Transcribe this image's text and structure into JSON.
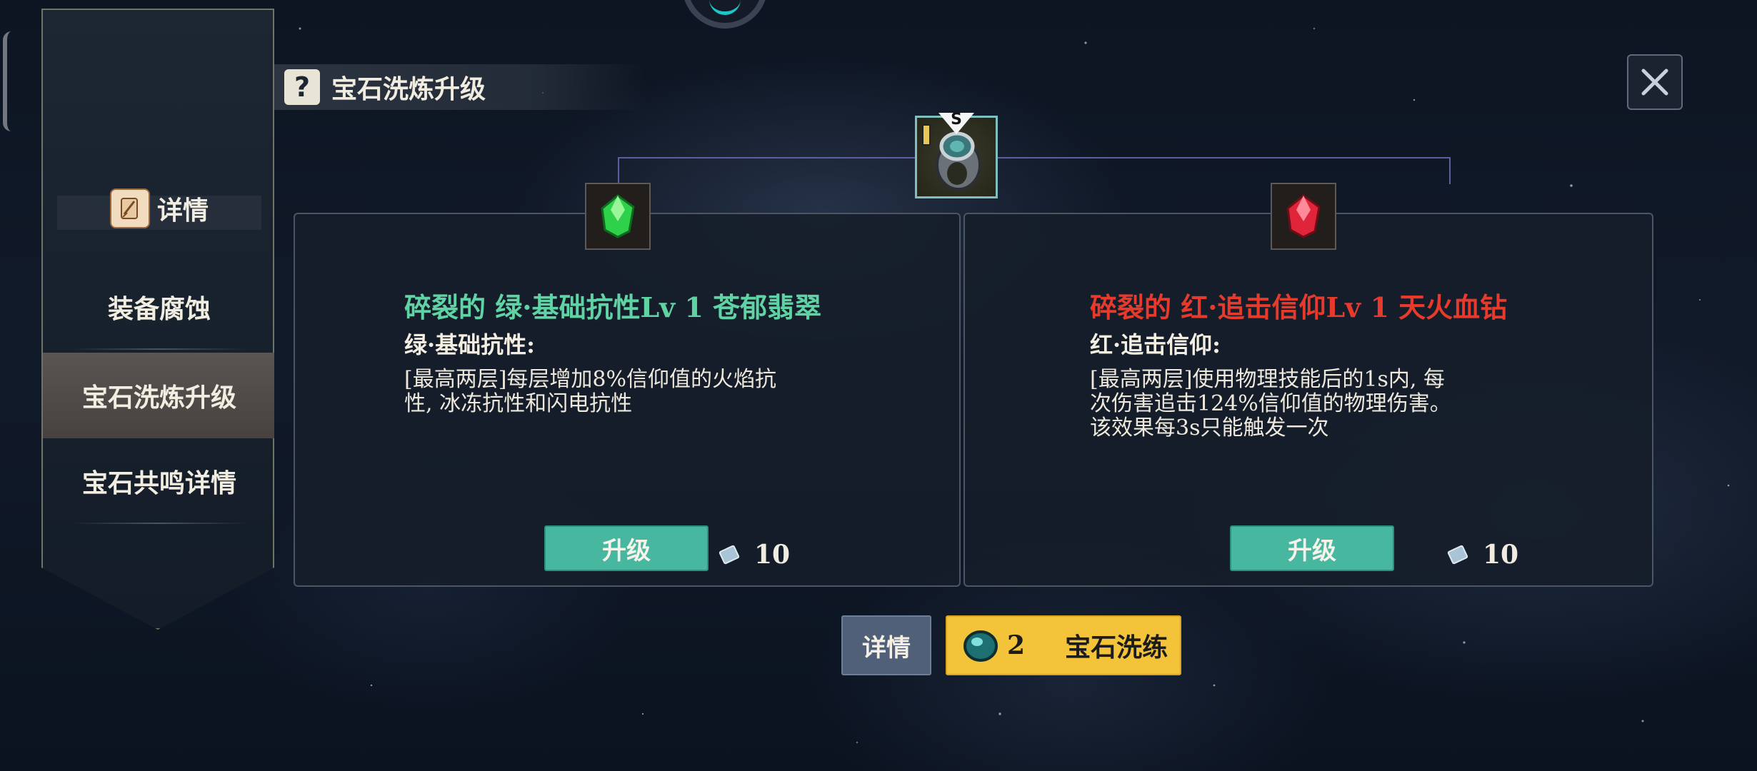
{
  "header": {
    "title": "宝石洗炼升级"
  },
  "sidebar": {
    "items": [
      {
        "label": "详情"
      },
      {
        "label": "装备腐蚀"
      },
      {
        "label": "宝石洗炼升级"
      },
      {
        "label": "宝石共鸣详情"
      }
    ],
    "active_index": 2
  },
  "equipment": {
    "grade_badge": "S"
  },
  "gems": [
    {
      "title": "碎裂的 绿·基础抗性Lv 1 苍郁翡翠",
      "color": "#5fd3a4",
      "stat_name": "绿·基础抗性:",
      "description_lines": [
        "[最高两层]每层增加8%信仰值的火焰抗",
        "性, 冰冻抗性和闪电抗性"
      ],
      "upgrade_label": "升级",
      "cost": "10"
    },
    {
      "title": "碎裂的 红·追击信仰Lv 1 天火血钻",
      "color": "#e63a2c",
      "stat_name": "红·追击信仰:",
      "description_lines": [
        "[最高两层]使用物理技能后的1s内, 每",
        "次伤害追击124%信仰值的物理伤害。",
        "该效果每3s只能触发一次"
      ],
      "upgrade_label": "升级",
      "cost": "10"
    }
  ],
  "footer": {
    "detail_label": "详情",
    "refine_count": "2",
    "refine_label": "宝石洗练"
  },
  "colors": {
    "accent_teal": "#48b7a0",
    "accent_gold": "#f3c43a",
    "detail_button": "#4f6078"
  }
}
